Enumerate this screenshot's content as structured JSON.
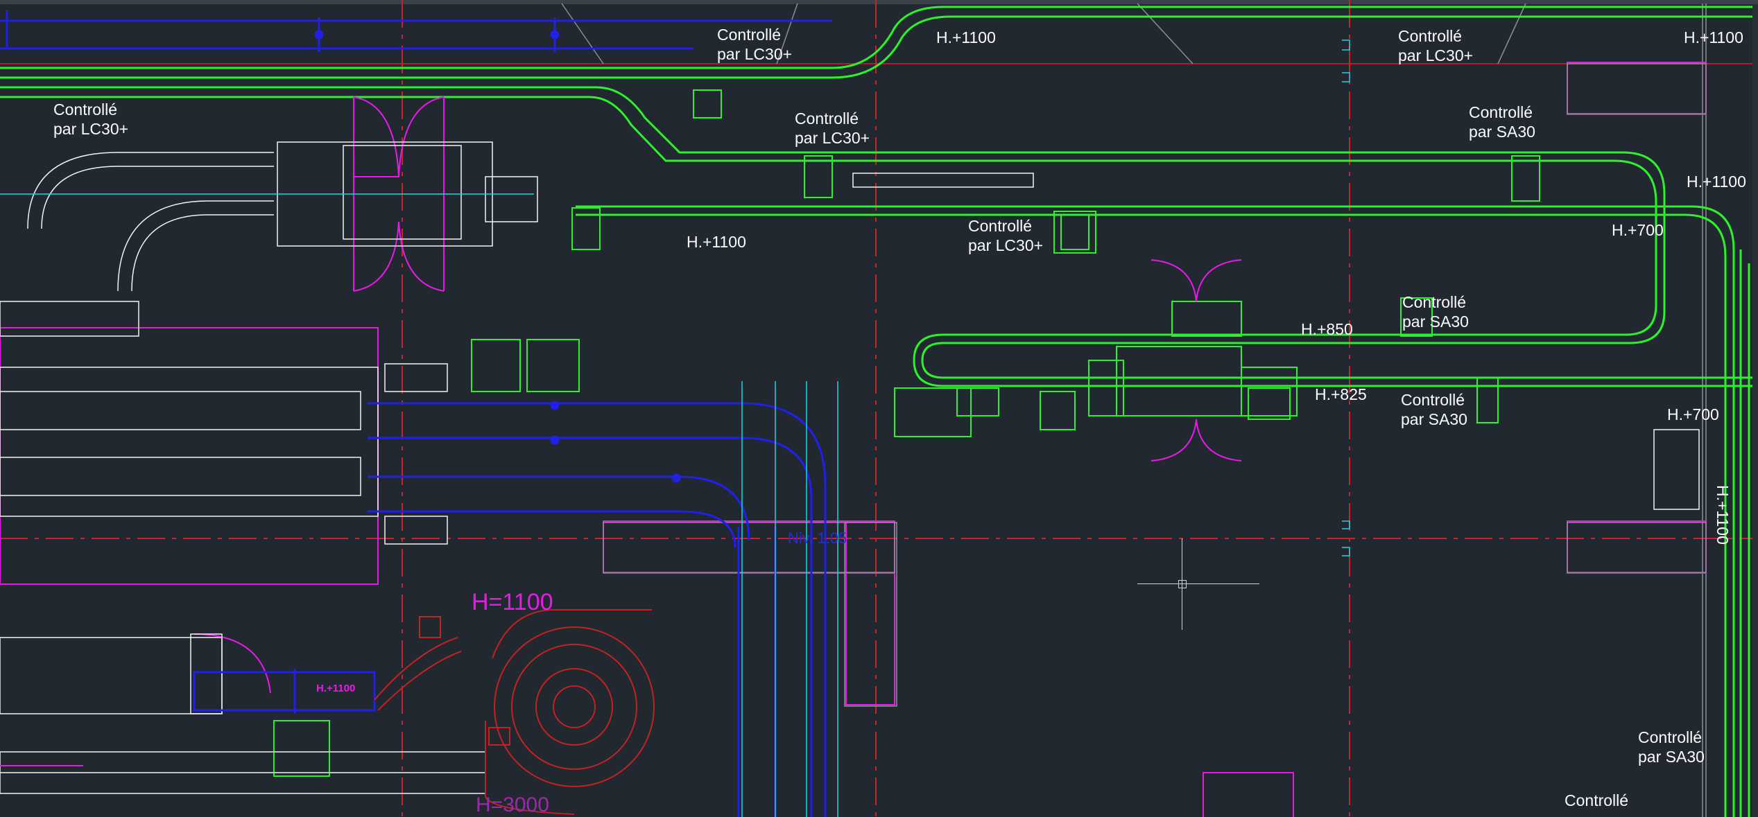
{
  "app": {
    "title": ""
  },
  "colors": {
    "background": "#212830",
    "conveyor_green": "#2cf22c",
    "blue_lines": "#2020e8",
    "magenta": "#e81ae8",
    "red_axis": "#c8242a",
    "cyan": "#1ad6e0",
    "white": "#f2f2f2",
    "red_conveyor": "#c22222"
  },
  "labels": {
    "c1_line1": "Controllé",
    "c1_line2": "par LC30+",
    "c2_line1": "Controllé",
    "c2_line2": "par LC30+",
    "c3_line1": "Controllé",
    "c3_line2": "par LC30+",
    "c4_line1": "Controllé",
    "c4_line2": "par LC30+",
    "c5_line1": "Controllé",
    "c5_line2": "par LC30+",
    "c6_line1": "Controllé",
    "c6_line2": "par SA30",
    "c7_line1": "Controllé",
    "c7_line2": "par SA30",
    "c8_line1": "Controllé",
    "c8_line2": "par SA30",
    "c9_line1": "Controllé",
    "c9_line2": "par SA30",
    "c10_line1": "Controllé",
    "h1": "H.+1100",
    "h2": "H.+1100",
    "h3": "H.+1100",
    "h4": "H.+1100",
    "h5": "H.+700",
    "h6": "H.+850",
    "h7": "H.+825",
    "h8": "H.+700",
    "h9": "H.+1100",
    "h_big": "H=1100",
    "h_small": "H.+1100",
    "h_bottom": "H=3000",
    "niv": "Niv. 1.05"
  },
  "icons": {
    "cursor": "crosshair-icon"
  }
}
